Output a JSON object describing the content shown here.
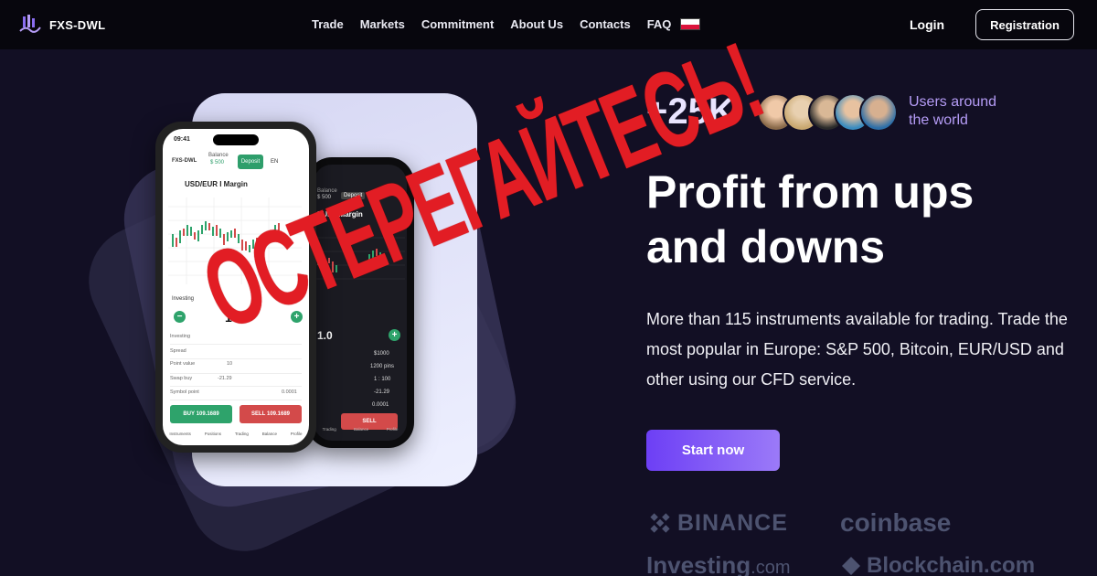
{
  "header": {
    "logo_text": "FXS-DWL",
    "nav": [
      "Trade",
      "Markets",
      "Commitment",
      "About Us",
      "Contacts",
      "FAQ"
    ],
    "login_label": "Login",
    "registration_label": "Registration"
  },
  "hero": {
    "users_count": "+25K",
    "users_text_line1": "Users around",
    "users_text_line2": "the world",
    "headline_line1": "Profit from ups",
    "headline_line2": "and downs",
    "description": "More than 115 instruments available for trading. Trade the most popular in Europe: S&P 500, Bitcoin, EUR/USD and other using our CFD service.",
    "cta_label": "Start now"
  },
  "partners": {
    "binance": "BINANCE",
    "coinbase": "coinbase",
    "investing": "Investing",
    "investing_suffix": ".com",
    "blockchain": "Blockchain.com"
  },
  "stamp_text": "ОСТЕРЕГАЙТЕСЬ!",
  "phone_front": {
    "time": "09:41",
    "balance_label": "Balance",
    "balance_value": "$ 500",
    "deposit_label": "Deposit",
    "lang": "EN",
    "pair": "USD/EUR I Margin",
    "investing_label": "Investing",
    "amount": "100",
    "rows": [
      "Investing",
      "Spread",
      "Point value",
      "Swap buy",
      "Symbol point"
    ],
    "row_values": [
      "",
      "",
      "10",
      "-21.29",
      "0.0001"
    ],
    "buy_label": "BUY",
    "buy_price": "109.1689",
    "sell_label": "SELL",
    "sell_price": "109.1689",
    "tabs": [
      "Instruments",
      "Positions",
      "Trading",
      "Balance",
      "Profile"
    ]
  },
  "phone_back": {
    "balance_label": "Balance",
    "balance_value": "$ 500",
    "deposit_label": "Deposit",
    "lang": "EN",
    "pair": "EUR I Margin",
    "amount": "1.0",
    "rows": [
      "$1000",
      "1200 pins",
      "1 : 100",
      "-21.29",
      "0.0001"
    ],
    "sell_label": "SELL",
    "sell_price": "109.1689",
    "tabs": [
      "Trading",
      "Balance",
      "Profile"
    ]
  },
  "colors": {
    "background": "#120f24",
    "header": "#07060d",
    "accent": "#7c4ff6",
    "stamp": "#e21d24",
    "buy": "#2ea36b",
    "sell": "#d34a4a"
  }
}
